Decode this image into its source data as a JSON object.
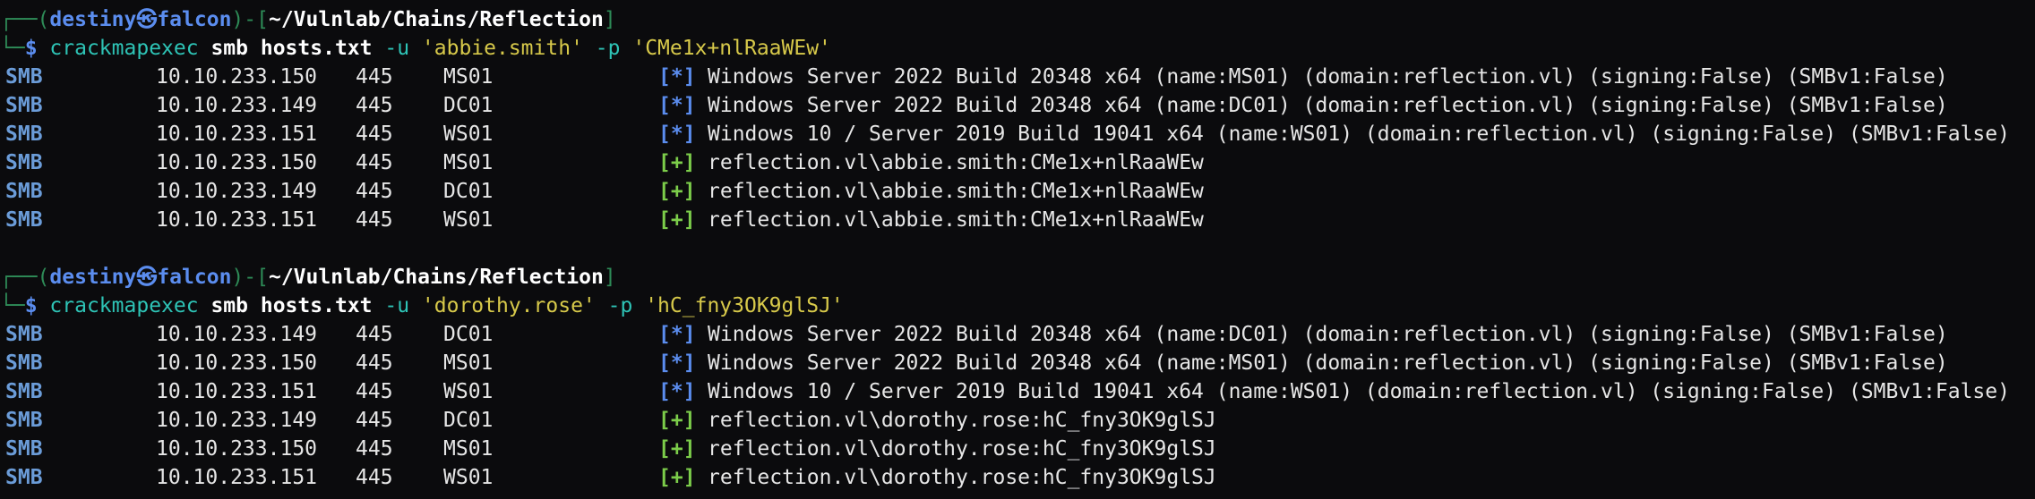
{
  "prompt": {
    "top_open": "┌──(",
    "user": "destiny",
    "at_glyph": "㉿",
    "host": "falcon",
    "mid": ")-[",
    "path": "~/Vulnlab/Chains/Reflection",
    "close": "]",
    "bottom": "└─",
    "dollar": "$"
  },
  "blocks": [
    {
      "command": {
        "tool": "crackmapexec",
        "proto": "smb",
        "target": "hosts.txt",
        "user_flag": "-u",
        "user": "'abbie.smith'",
        "pass_flag": "-p",
        "pass": "'CMe1x+nlRaaWEw'"
      },
      "rows": [
        {
          "proto": "SMB",
          "ip": "10.10.233.150",
          "port": "445",
          "name": "MS01",
          "tag": "[*]",
          "tag_type": "info",
          "msg": "Windows Server 2022 Build 20348 x64 (name:MS01) (domain:reflection.vl) (signing:False) (SMBv1:False)"
        },
        {
          "proto": "SMB",
          "ip": "10.10.233.149",
          "port": "445",
          "name": "DC01",
          "tag": "[*]",
          "tag_type": "info",
          "msg": "Windows Server 2022 Build 20348 x64 (name:DC01) (domain:reflection.vl) (signing:False) (SMBv1:False)"
        },
        {
          "proto": "SMB",
          "ip": "10.10.233.151",
          "port": "445",
          "name": "WS01",
          "tag": "[*]",
          "tag_type": "info",
          "msg": "Windows 10 / Server 2019 Build 19041 x64 (name:WS01) (domain:reflection.vl) (signing:False) (SMBv1:False)"
        },
        {
          "proto": "SMB",
          "ip": "10.10.233.150",
          "port": "445",
          "name": "MS01",
          "tag": "[+]",
          "tag_type": "ok",
          "msg": "reflection.vl\\abbie.smith:CMe1x+nlRaaWEw"
        },
        {
          "proto": "SMB",
          "ip": "10.10.233.149",
          "port": "445",
          "name": "DC01",
          "tag": "[+]",
          "tag_type": "ok",
          "msg": "reflection.vl\\abbie.smith:CMe1x+nlRaaWEw"
        },
        {
          "proto": "SMB",
          "ip": "10.10.233.151",
          "port": "445",
          "name": "WS01",
          "tag": "[+]",
          "tag_type": "ok",
          "msg": "reflection.vl\\abbie.smith:CMe1x+nlRaaWEw"
        }
      ]
    },
    {
      "command": {
        "tool": "crackmapexec",
        "proto": "smb",
        "target": "hosts.txt",
        "user_flag": "-u",
        "user": "'dorothy.rose'",
        "pass_flag": "-p",
        "pass": "'hC_fny3OK9glSJ'"
      },
      "rows": [
        {
          "proto": "SMB",
          "ip": "10.10.233.149",
          "port": "445",
          "name": "DC01",
          "tag": "[*]",
          "tag_type": "info",
          "msg": "Windows Server 2022 Build 20348 x64 (name:DC01) (domain:reflection.vl) (signing:False) (SMBv1:False)"
        },
        {
          "proto": "SMB",
          "ip": "10.10.233.150",
          "port": "445",
          "name": "MS01",
          "tag": "[*]",
          "tag_type": "info",
          "msg": "Windows Server 2022 Build 20348 x64 (name:MS01) (domain:reflection.vl) (signing:False) (SMBv1:False)"
        },
        {
          "proto": "SMB",
          "ip": "10.10.233.151",
          "port": "445",
          "name": "WS01",
          "tag": "[*]",
          "tag_type": "info",
          "msg": "Windows 10 / Server 2019 Build 19041 x64 (name:WS01) (domain:reflection.vl) (signing:False) (SMBv1:False)"
        },
        {
          "proto": "SMB",
          "ip": "10.10.233.149",
          "port": "445",
          "name": "DC01",
          "tag": "[+]",
          "tag_type": "ok",
          "msg": "reflection.vl\\dorothy.rose:hC_fny3OK9glSJ"
        },
        {
          "proto": "SMB",
          "ip": "10.10.233.150",
          "port": "445",
          "name": "MS01",
          "tag": "[+]",
          "tag_type": "ok",
          "msg": "reflection.vl\\dorothy.rose:hC_fny3OK9glSJ"
        },
        {
          "proto": "SMB",
          "ip": "10.10.233.151",
          "port": "445",
          "name": "WS01",
          "tag": "[+]",
          "tag_type": "ok",
          "msg": "reflection.vl\\dorothy.rose:hC_fny3OK9glSJ"
        }
      ]
    }
  ]
}
